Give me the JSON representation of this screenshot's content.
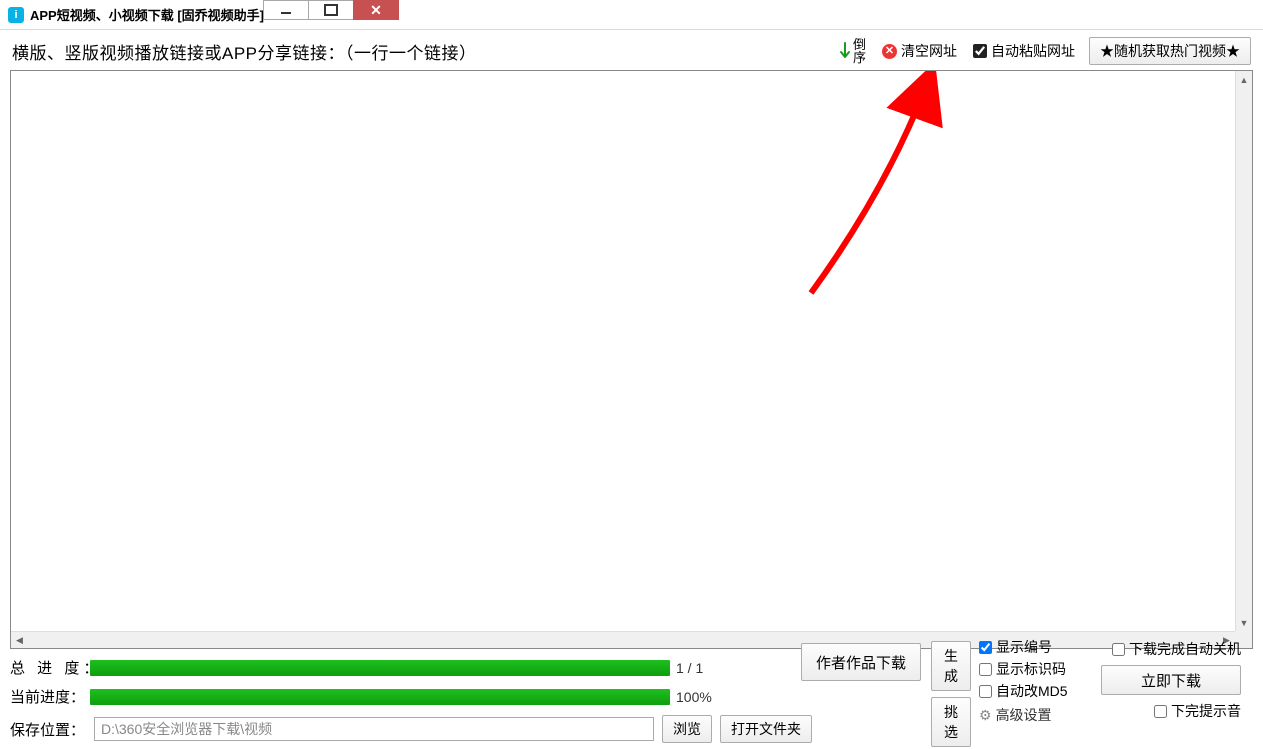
{
  "window": {
    "title": "APP短视频、小视频下载 [固乔视频助手]"
  },
  "top": {
    "label": "横版、竖版视频播放链接或APP分享链接：（一行一个链接）",
    "reverse": "倒序",
    "clear_url": "清空网址",
    "auto_paste": "自动粘贴网址",
    "random_hot": "★随机获取热门视频★"
  },
  "progress": {
    "total_label": "总 进 度：",
    "total_value": "1 / 1",
    "current_label": "当前进度：",
    "current_value": "100%"
  },
  "path": {
    "label": "保存位置：",
    "value": "D:\\360安全浏览器下载\\视频",
    "browse": "浏览",
    "open_folder": "打开文件夹"
  },
  "actions": {
    "author_dl": "作者作品下载",
    "gen": "生成",
    "pick": "挑选"
  },
  "opts": {
    "show_no": "显示编号",
    "show_id": "显示标识码",
    "auto_md5": "自动改MD5",
    "advanced": "高级设置"
  },
  "right": {
    "auto_shutdown": "下载完成自动关机",
    "download_now": "立即下载",
    "done_sound": "下完提示音"
  }
}
